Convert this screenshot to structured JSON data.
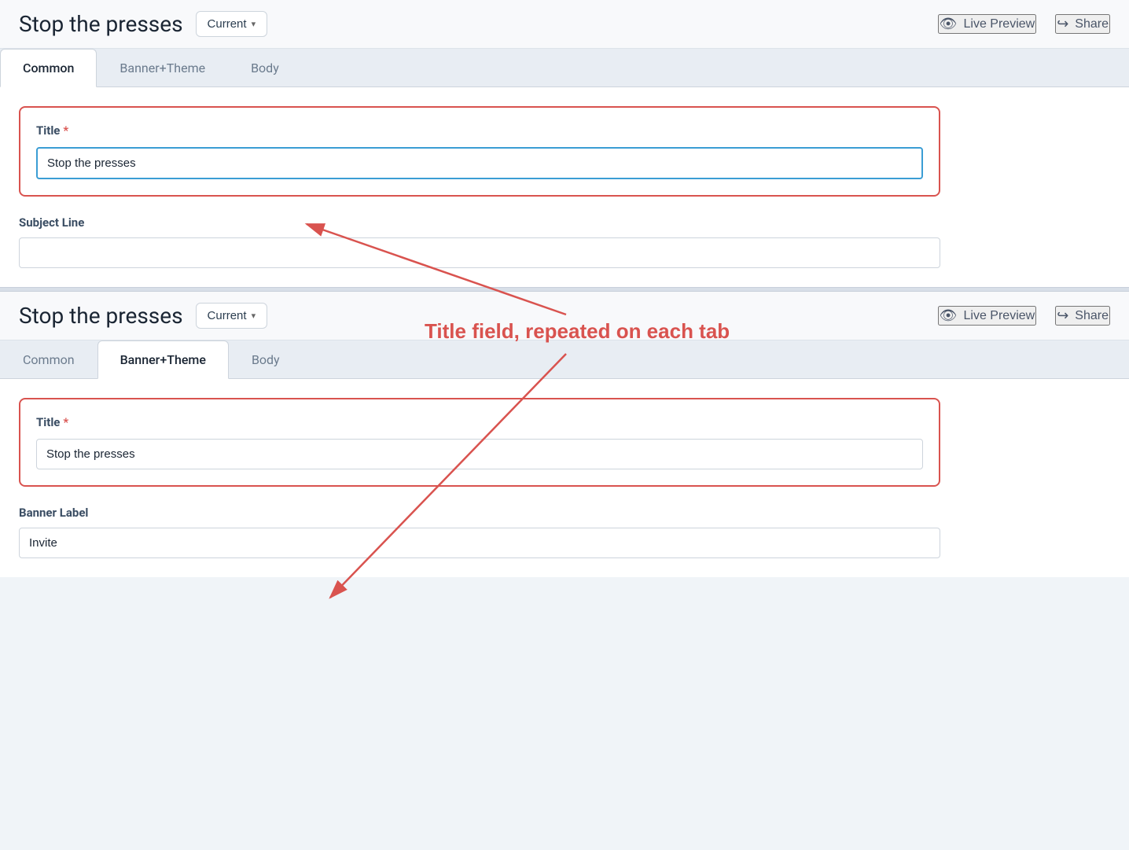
{
  "app": {
    "title": "Stop the presses"
  },
  "header1": {
    "title": "Stop the presses",
    "dropdown_label": "Current",
    "live_preview_label": "Live Preview",
    "share_label": "Share"
  },
  "header2": {
    "title": "Stop the presses",
    "dropdown_label": "Current",
    "live_preview_label": "Live Preview",
    "share_label": "Share"
  },
  "tabs1": {
    "items": [
      {
        "label": "Common",
        "active": true
      },
      {
        "label": "Banner+Theme",
        "active": false
      },
      {
        "label": "Body",
        "active": false
      }
    ]
  },
  "tabs2": {
    "items": [
      {
        "label": "Common",
        "active": false
      },
      {
        "label": "Banner+Theme",
        "active": true
      },
      {
        "label": "Body",
        "active": false
      }
    ]
  },
  "panel1": {
    "title_label": "Title",
    "title_required": "*",
    "title_value": "Stop the presses",
    "subject_label": "Subject Line",
    "subject_value": ""
  },
  "panel2": {
    "title_label": "Title",
    "title_required": "*",
    "title_value": "Stop the presses",
    "banner_label": "Banner Label",
    "banner_value": "Invite"
  },
  "annotation": {
    "text": "Title field, repeated on each tab"
  }
}
